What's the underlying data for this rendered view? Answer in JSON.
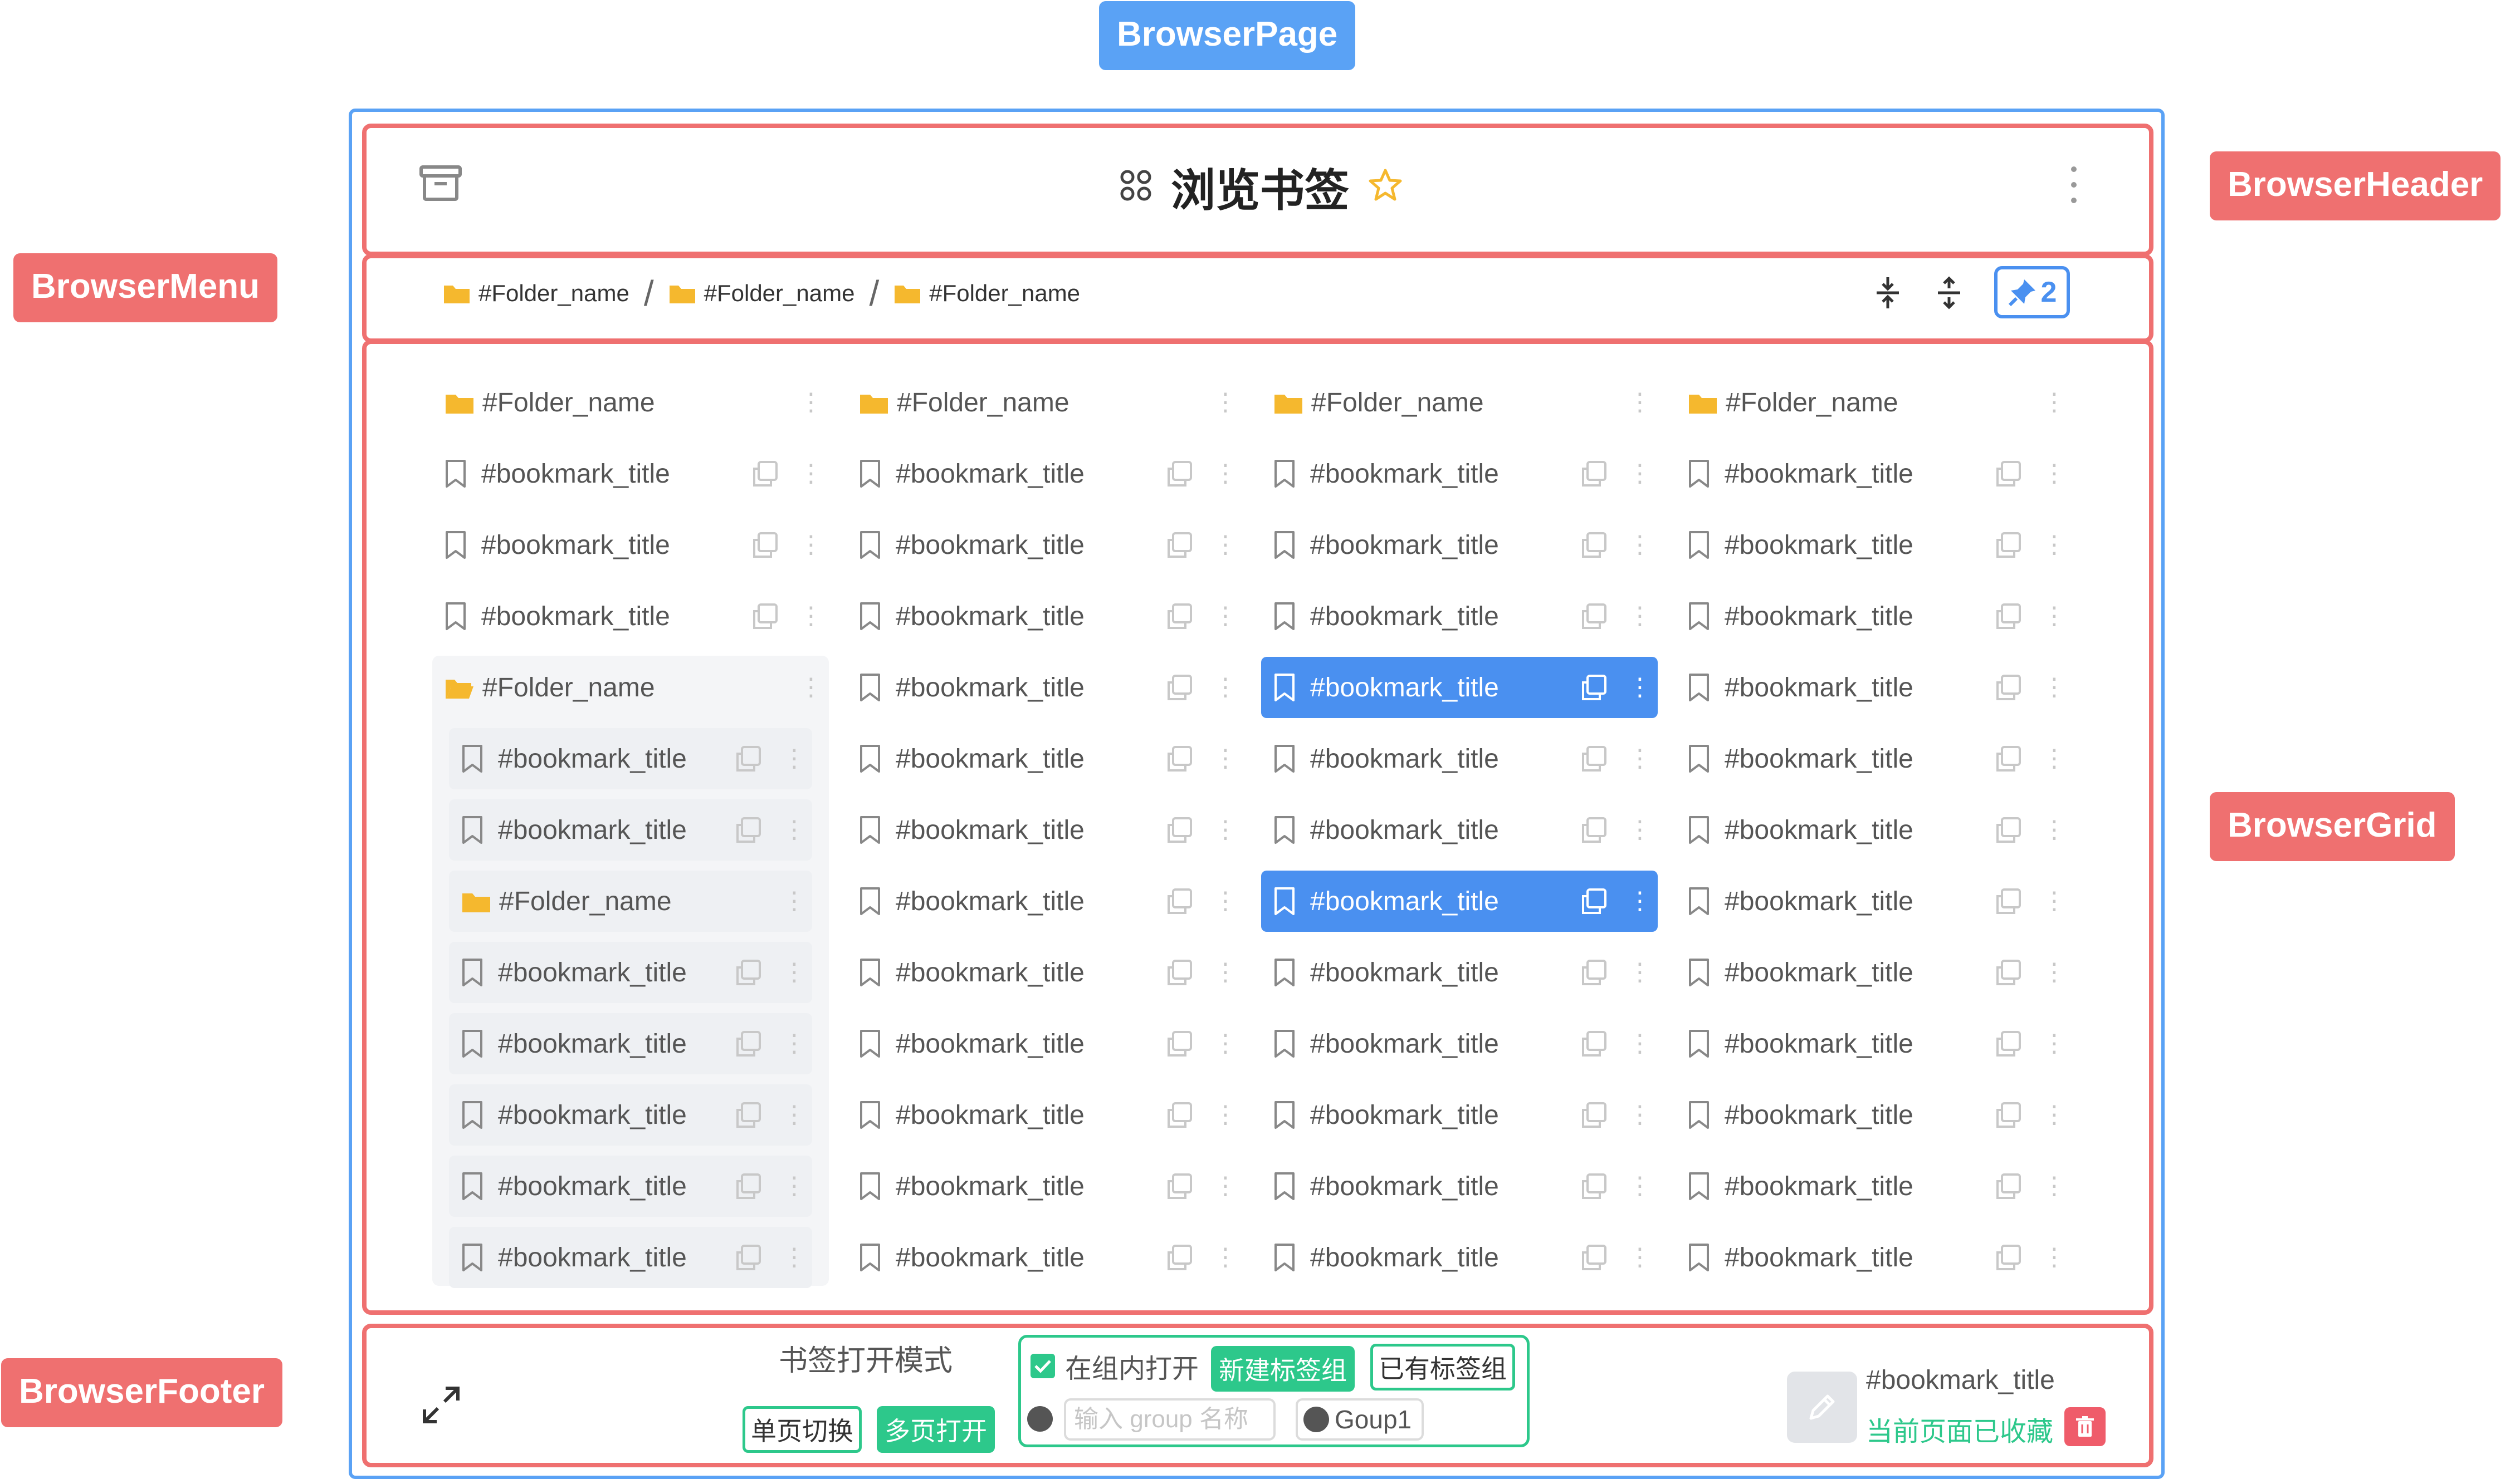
{
  "labels": {
    "page": "BrowserPage",
    "header": "BrowserHeader",
    "menu": "BrowserMenu",
    "grid": "BrowserGrid",
    "footer": "BrowserFooter"
  },
  "header": {
    "title": "浏览书签"
  },
  "breadcrumb": {
    "items": [
      "#Folder_name",
      "#Folder_name",
      "#Folder_name"
    ],
    "separator": "/"
  },
  "pin": {
    "count": "2"
  },
  "grid": {
    "columns": [
      {
        "rows": [
          {
            "type": "folder",
            "label": "#Folder_name"
          },
          {
            "type": "bookmark",
            "label": "#bookmark_title"
          },
          {
            "type": "bookmark",
            "label": "#bookmark_title"
          },
          {
            "type": "bookmark",
            "label": "#bookmark_title"
          },
          {
            "type": "folder-open",
            "label": "#Folder_name"
          },
          {
            "type": "bookmark",
            "label": "#bookmark_title",
            "indent": true
          },
          {
            "type": "bookmark",
            "label": "#bookmark_title",
            "indent": true
          },
          {
            "type": "folder",
            "label": "#Folder_name",
            "indent": true
          },
          {
            "type": "bookmark",
            "label": "#bookmark_title",
            "indent": true
          },
          {
            "type": "bookmark",
            "label": "#bookmark_title",
            "indent": true
          },
          {
            "type": "bookmark",
            "label": "#bookmark_title",
            "indent": true
          },
          {
            "type": "bookmark",
            "label": "#bookmark_title",
            "indent": true
          },
          {
            "type": "bookmark",
            "label": "#bookmark_title",
            "indent": true
          }
        ]
      },
      {
        "rows": [
          {
            "type": "folder",
            "label": "#Folder_name"
          },
          {
            "type": "bookmark",
            "label": "#bookmark_title"
          },
          {
            "type": "bookmark",
            "label": "#bookmark_title"
          },
          {
            "type": "bookmark",
            "label": "#bookmark_title"
          },
          {
            "type": "bookmark",
            "label": "#bookmark_title"
          },
          {
            "type": "bookmark",
            "label": "#bookmark_title"
          },
          {
            "type": "bookmark",
            "label": "#bookmark_title"
          },
          {
            "type": "bookmark",
            "label": "#bookmark_title"
          },
          {
            "type": "bookmark",
            "label": "#bookmark_title"
          },
          {
            "type": "bookmark",
            "label": "#bookmark_title"
          },
          {
            "type": "bookmark",
            "label": "#bookmark_title"
          },
          {
            "type": "bookmark",
            "label": "#bookmark_title"
          },
          {
            "type": "bookmark",
            "label": "#bookmark_title"
          }
        ]
      },
      {
        "rows": [
          {
            "type": "folder",
            "label": "#Folder_name"
          },
          {
            "type": "bookmark",
            "label": "#bookmark_title"
          },
          {
            "type": "bookmark",
            "label": "#bookmark_title"
          },
          {
            "type": "bookmark",
            "label": "#bookmark_title"
          },
          {
            "type": "bookmark",
            "label": "#bookmark_title",
            "selected": true
          },
          {
            "type": "bookmark",
            "label": "#bookmark_title"
          },
          {
            "type": "bookmark",
            "label": "#bookmark_title"
          },
          {
            "type": "bookmark",
            "label": "#bookmark_title",
            "selected": true
          },
          {
            "type": "bookmark",
            "label": "#bookmark_title"
          },
          {
            "type": "bookmark",
            "label": "#bookmark_title"
          },
          {
            "type": "bookmark",
            "label": "#bookmark_title"
          },
          {
            "type": "bookmark",
            "label": "#bookmark_title"
          },
          {
            "type": "bookmark",
            "label": "#bookmark_title"
          }
        ]
      },
      {
        "rows": [
          {
            "type": "folder",
            "label": "#Folder_name"
          },
          {
            "type": "bookmark",
            "label": "#bookmark_title"
          },
          {
            "type": "bookmark",
            "label": "#bookmark_title"
          },
          {
            "type": "bookmark",
            "label": "#bookmark_title"
          },
          {
            "type": "bookmark",
            "label": "#bookmark_title"
          },
          {
            "type": "bookmark",
            "label": "#bookmark_title"
          },
          {
            "type": "bookmark",
            "label": "#bookmark_title"
          },
          {
            "type": "bookmark",
            "label": "#bookmark_title"
          },
          {
            "type": "bookmark",
            "label": "#bookmark_title"
          },
          {
            "type": "bookmark",
            "label": "#bookmark_title"
          },
          {
            "type": "bookmark",
            "label": "#bookmark_title"
          },
          {
            "type": "bookmark",
            "label": "#bookmark_title"
          },
          {
            "type": "bookmark",
            "label": "#bookmark_title"
          }
        ]
      }
    ]
  },
  "footer": {
    "open_mode_label": "书签打开模式",
    "single_page": "单页切换",
    "multi_page": "多页打开",
    "open_in_group": "在组内打开",
    "new_group": "新建标签组",
    "existing_group": "已有标签组",
    "group_name_placeholder": "输入 group 名称",
    "group_option": "Goup1",
    "bookmark_title": "#bookmark_title",
    "saved_status": "当前页面已收藏"
  },
  "colors": {
    "accent_blue": "#5aa2f5",
    "frame_red": "#ef7070",
    "selected": "#4a90f0",
    "green": "#2dc88b",
    "folder": "#f5b82e",
    "delete": "#ef5c6a"
  },
  "icons": [
    "archive-icon",
    "apps-icon",
    "star-icon",
    "more-vertical-icon",
    "folder-icon",
    "collapse-icon",
    "expand-icon",
    "pin-icon",
    "bookmark-icon",
    "copy-icon",
    "fullscreen-icon",
    "edit-icon",
    "trash-icon",
    "checkbox-icon",
    "radio-icon"
  ]
}
